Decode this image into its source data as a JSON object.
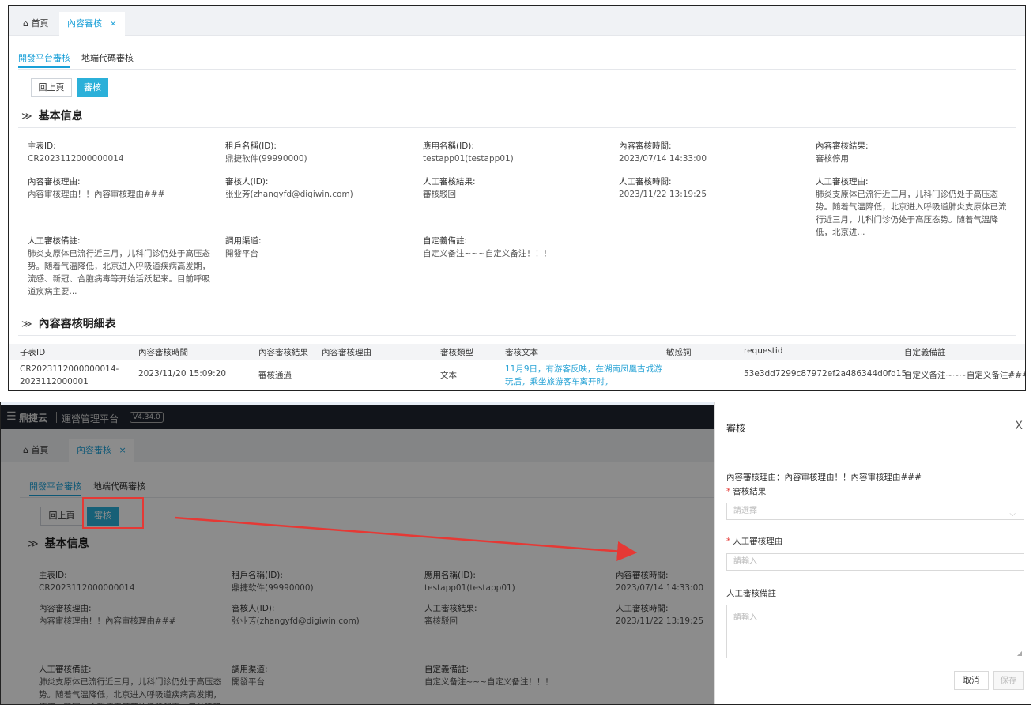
{
  "top": {
    "tabs": [
      {
        "label": "首頁",
        "icon": "home-icon"
      },
      {
        "label": "內容審核",
        "close": "×"
      }
    ],
    "sub_tabs": [
      "開發平台審核",
      "地端代碼審核"
    ],
    "buttons": {
      "back": "回上頁",
      "review": "審核"
    },
    "basic_section": {
      "chevron": "≫",
      "title": "基本信息"
    },
    "fields": [
      {
        "label": "主表ID:",
        "value": "CR2023112000000014"
      },
      {
        "label": "租戶名稱(ID):",
        "value": "鼎捷软件(99990000)"
      },
      {
        "label": "應用名稱(ID):",
        "value": "testapp01(testapp01)"
      },
      {
        "label": "內容審核時間:",
        "value": "2023/07/14 14:33:00"
      },
      {
        "label": "內容審核結果:",
        "value": "審核停用"
      },
      {
        "label": "內容審核理由:",
        "value": "內容审核理由！！內容审核理由###"
      },
      {
        "label": "審核人(ID):",
        "value": "张业芳(zhangyfd@digiwin.com)"
      },
      {
        "label": "人工審核結果:",
        "value": "審核駁回"
      },
      {
        "label": "人工審核時間:",
        "value": "2023/11/22 13:19:25"
      },
      {
        "label": "人工審核理由:",
        "value": "肺炎支原体已流行近三月，儿科门诊仍处于高压态势。随着气温降低，北京进入呼吸道肺炎支原体已流行近三月，儿科门诊仍处于高压态势。随着气温降低，北京进..."
      },
      {
        "label": "人工審核備註:",
        "value": "肺炎支原体已流行近三月，儿科门诊仍处于高压态势。随着气温降低，北京进入呼吸道疾病高发期，流感、新冠、合胞病毒等开始活跃起来。目前呼吸道疾病主要..."
      },
      {
        "label": "調用渠道:",
        "value": "開發平台"
      },
      {
        "label": "自定義備註:",
        "value": "自定义备注~~~自定义备注！！！"
      }
    ],
    "detail_section": {
      "chevron": "≫",
      "title": "內容審核明細表"
    },
    "table": {
      "headers": [
        "子表ID",
        "內容審核時間",
        "內容審核結果",
        "內容審核理由",
        "審核類型",
        "審核文本",
        "敏感詞",
        "requestid",
        "自定義備註"
      ],
      "rows": [
        {
          "id": "CR2023112000000014-2023112000001",
          "time": "2023/11/20 15:09:20",
          "result": "審核通過",
          "reason": "",
          "type": "文本",
          "text": "11月9日，有游客反映，在湖南凤凰古城游玩后，乘坐旅游客车离开时，",
          "sensitive": "",
          "requestid": "53e3dd7299c87972ef2a486344d0fd15",
          "remark": "自定义备注~~~自定义备注#####"
        }
      ]
    }
  },
  "bottom": {
    "header": {
      "menu_icon": "☰",
      "logo": "鼎捷云",
      "platform": "運營管理平台",
      "version": "V4.34.0"
    },
    "tabs": [
      {
        "label": "首頁"
      },
      {
        "label": "內容審核",
        "close": "×"
      }
    ],
    "sub_tabs": [
      "開發平台審核",
      "地端代碼審核"
    ],
    "buttons": {
      "back": "回上頁",
      "review": "審核"
    },
    "basic_section": {
      "chevron": "≫",
      "title": "基本信息"
    },
    "fields": [
      {
        "label": "主表ID:",
        "value": "CR2023112000000014"
      },
      {
        "label": "租戶名稱(ID):",
        "value": "鼎捷软件(99990000)"
      },
      {
        "label": "應用名稱(ID):",
        "value": "testapp01(testapp01)"
      },
      {
        "label": "內容審核時間:",
        "value": "2023/07/14 14:33:00"
      },
      {
        "label": "內容審核理由:",
        "value": "內容审核理由！！內容审核理由###"
      },
      {
        "label": "審核人(ID):",
        "value": "张业芳(zhangyfd@digiwin.com)"
      },
      {
        "label": "人工審核結果:",
        "value": "審核駁回"
      },
      {
        "label": "人工審核時間:",
        "value": "2023/11/22 13:19:25"
      },
      {
        "label": "人工審核備註:",
        "value": "肺炎支原体已流行近三月，儿科门诊仍处于高压态势。随着气温降低，北京进入呼吸道疾病高发期，流感、新冠、合胞病毒等开始活跃起来。目前呼吸道疾病主要..."
      },
      {
        "label": "調用渠道:",
        "value": "開發平台"
      },
      {
        "label": "自定義備註:",
        "value": "自定义备注~~~自定义备注！！！"
      }
    ],
    "drawer": {
      "title": "審核",
      "close": "X",
      "reason_text": "內容審核理由：內容审核理由！！內容审核理由###",
      "result_label": "審核結果",
      "result_placeholder": "請選擇",
      "manual_reason_label": "人工審核理由",
      "manual_reason_placeholder": "請輸入",
      "remark_label": "人工審核備註",
      "remark_placeholder": "請輸入",
      "cancel": "取消",
      "save": "保存"
    }
  },
  "colors": {
    "accent": "#1aa0d8",
    "primary_button": "#2bb0d9",
    "highlight": "#e53935",
    "header_bg": "#1f2530"
  }
}
